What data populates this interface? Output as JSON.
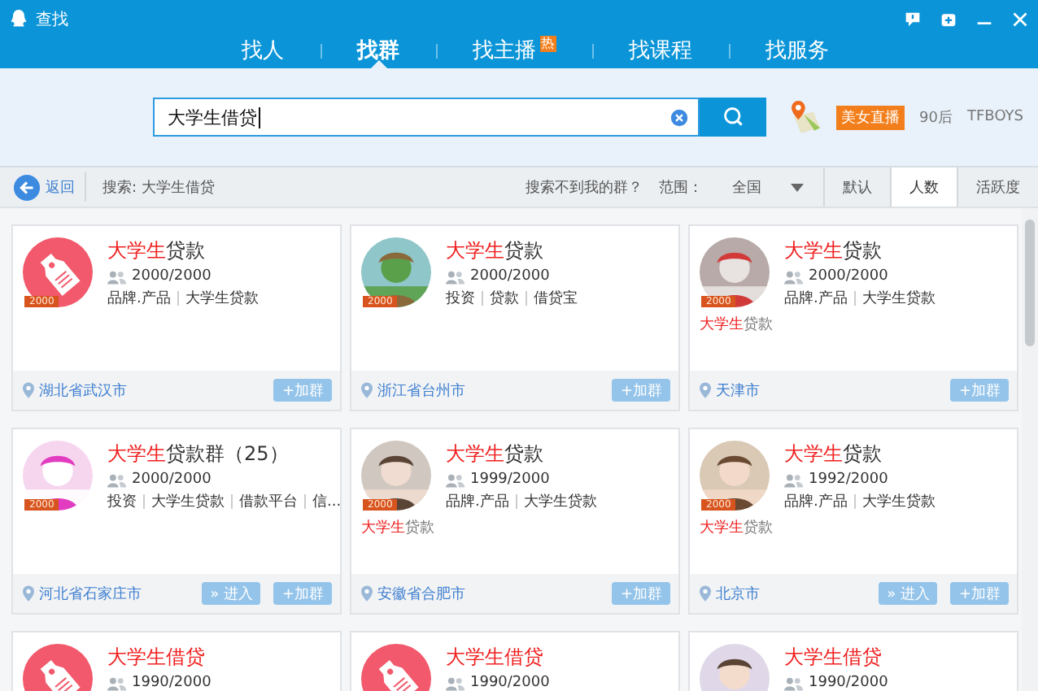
{
  "window": {
    "title": "查找"
  },
  "nav_tabs": [
    {
      "label": "找人",
      "selected": false
    },
    {
      "label": "找群",
      "selected": true
    },
    {
      "label": "找主播",
      "selected": false,
      "badge": "热"
    },
    {
      "label": "找课程",
      "selected": false
    },
    {
      "label": "找服务",
      "selected": false
    }
  ],
  "search": {
    "value": "大学生借贷"
  },
  "hot_tags": [
    {
      "label": "美女直播",
      "kind": "highlight"
    },
    {
      "label": "90后",
      "kind": "plain"
    },
    {
      "label": "TFBOYS",
      "kind": "plain"
    }
  ],
  "filter_bar": {
    "back": "返回",
    "query": "搜索: 大学生借贷",
    "not_found": "搜索不到我的群？",
    "range_label": "范围：",
    "range_value": "全国",
    "sort_tabs": [
      {
        "label": "默认",
        "selected": false
      },
      {
        "label": "人数",
        "selected": true
      },
      {
        "label": "活跃度",
        "selected": false
      }
    ]
  },
  "groups": [
    {
      "avatar": {
        "kind": "tag"
      },
      "badge": "2000",
      "title_highlight": "大学生",
      "title_rest": "贷款",
      "members": "2000/2000",
      "tags": [
        "品牌.产品",
        "大学生贷款"
      ],
      "location": "湖北省武汉市",
      "buttons": [
        "+加群"
      ]
    },
    {
      "avatar": {
        "kind": "picture"
      },
      "badge": "2000",
      "title_highlight": "大学生",
      "title_rest": "贷款",
      "members": "2000/2000",
      "tags": [
        "投资",
        "贷款",
        "借贷宝"
      ],
      "location": "浙江省台州市",
      "buttons": [
        "+加群"
      ]
    },
    {
      "avatar": {
        "kind": "picture"
      },
      "badge": "2000",
      "title_highlight": "大学生",
      "title_rest": "贷款",
      "members": "2000/2000",
      "tags": [
        "品牌.产品",
        "大学生贷款"
      ],
      "desc_highlight": "大学生",
      "desc_rest": "贷款",
      "location": "天津市",
      "buttons": [
        "+加群"
      ]
    },
    {
      "avatar": {
        "kind": "picture"
      },
      "badge": "2000",
      "title_highlight": "大学生",
      "title_rest": "贷款群（25）",
      "members": "2000/2000",
      "tags": [
        "投资",
        "大学生贷款",
        "借款平台",
        "信..."
      ],
      "location": "河北省石家庄市",
      "buttons": [
        "» 进入",
        "+加群"
      ]
    },
    {
      "avatar": {
        "kind": "picture"
      },
      "badge": "2000",
      "title_highlight": "大学生",
      "title_rest": "贷款",
      "members": "1999/2000",
      "tags": [
        "品牌.产品",
        "大学生贷款"
      ],
      "desc_highlight": "大学生",
      "desc_rest": "贷款",
      "location": "安徽省合肥市",
      "buttons": [
        "+加群"
      ]
    },
    {
      "avatar": {
        "kind": "picture"
      },
      "badge": "2000",
      "title_highlight": "大学生",
      "title_rest": "贷款",
      "members": "1992/2000",
      "tags": [
        "品牌.产品",
        "大学生贷款"
      ],
      "desc_highlight": "大学生",
      "desc_rest": "贷款",
      "location": "北京市",
      "buttons": [
        "» 进入",
        "+加群"
      ]
    },
    {
      "avatar": {
        "kind": "tag"
      },
      "title_highlight": "大学生借贷",
      "members": "1990/2000"
    },
    {
      "avatar": {
        "kind": "tag"
      },
      "title_highlight": "大学生借贷",
      "members": "1990/2000"
    },
    {
      "avatar": {
        "kind": "picture"
      },
      "title_highlight": "大学生借贷",
      "members": "1990/2000"
    }
  ]
}
